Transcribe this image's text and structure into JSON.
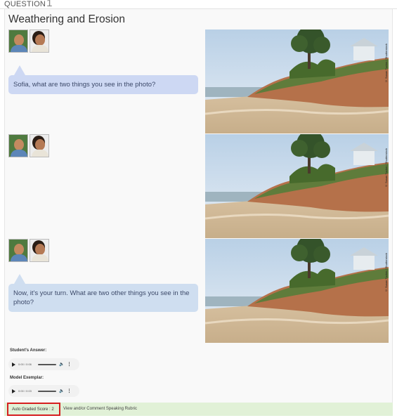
{
  "question": {
    "label": "QUESTION",
    "number": "1"
  },
  "title": "Weathering and Erosion",
  "dialogue": [
    {
      "text": "Sofia, what are two things you see in the photo?"
    },
    {
      "text": ""
    },
    {
      "text": "Now, it's your turn. What are two other things you see in the photo?"
    }
  ],
  "photo": {
    "credit": "© Susan Tucker / Shutterstock"
  },
  "student_answer": {
    "label": "Student's Answer:",
    "time": "0:00 / 0:06"
  },
  "model_exemplar": {
    "label": "Model Exemplar:",
    "time": "0:00 / 0:03"
  },
  "footer": {
    "score_label": "Auto Graded Score : 2",
    "rubric_link": "View and/or Comment Speaking Rubric"
  },
  "colors": {
    "bubble": "#cdd8f3",
    "footer_bg": "#e1f1d7",
    "score_border": "#d61f1f"
  }
}
